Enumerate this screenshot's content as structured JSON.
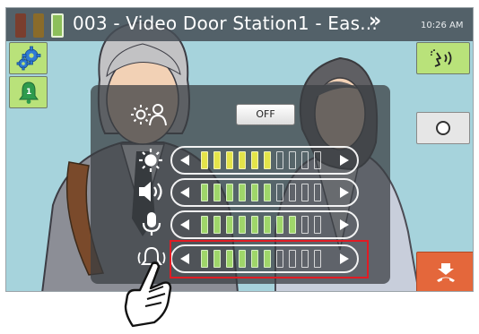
{
  "status_bar": {
    "title": "003 - Video Door Station1 - Eas...",
    "more_symbol": "»",
    "time": "10:26 AM"
  },
  "side_buttons": {
    "settings": {
      "icon": "gear-icon"
    },
    "notification": {
      "icon": "bell-icon",
      "badge": "1"
    },
    "talk": {
      "icon": "voice-talk-icon"
    },
    "record": {
      "icon": "record-circle-icon"
    },
    "end_call": {
      "icon": "hang-up-icon"
    }
  },
  "adjust_panel": {
    "off_label": "OFF",
    "rows": [
      {
        "name": "brightness",
        "icon": "brightness-icon",
        "level": 6,
        "total": 10,
        "color": "#e4e44a"
      },
      {
        "name": "receive-volume",
        "icon": "speaker-volume-icon",
        "level": 6,
        "total": 10,
        "color": "#9fd66a"
      },
      {
        "name": "transmit-volume",
        "icon": "microphone-icon",
        "level": 8,
        "total": 10,
        "color": "#9fd66a"
      },
      {
        "name": "ringtone-volume",
        "icon": "ringtone-bell-icon",
        "level": 6,
        "total": 10,
        "color": "#9fd66a"
      }
    ]
  },
  "colors": {
    "active_green": "#9fd66a",
    "active_yellow": "#e4e44a",
    "highlight_red": "#e21b23",
    "side_button_green": "#b9e27a",
    "side_button_grey": "#e6e6e6",
    "end_call_orange": "#e4673b"
  }
}
